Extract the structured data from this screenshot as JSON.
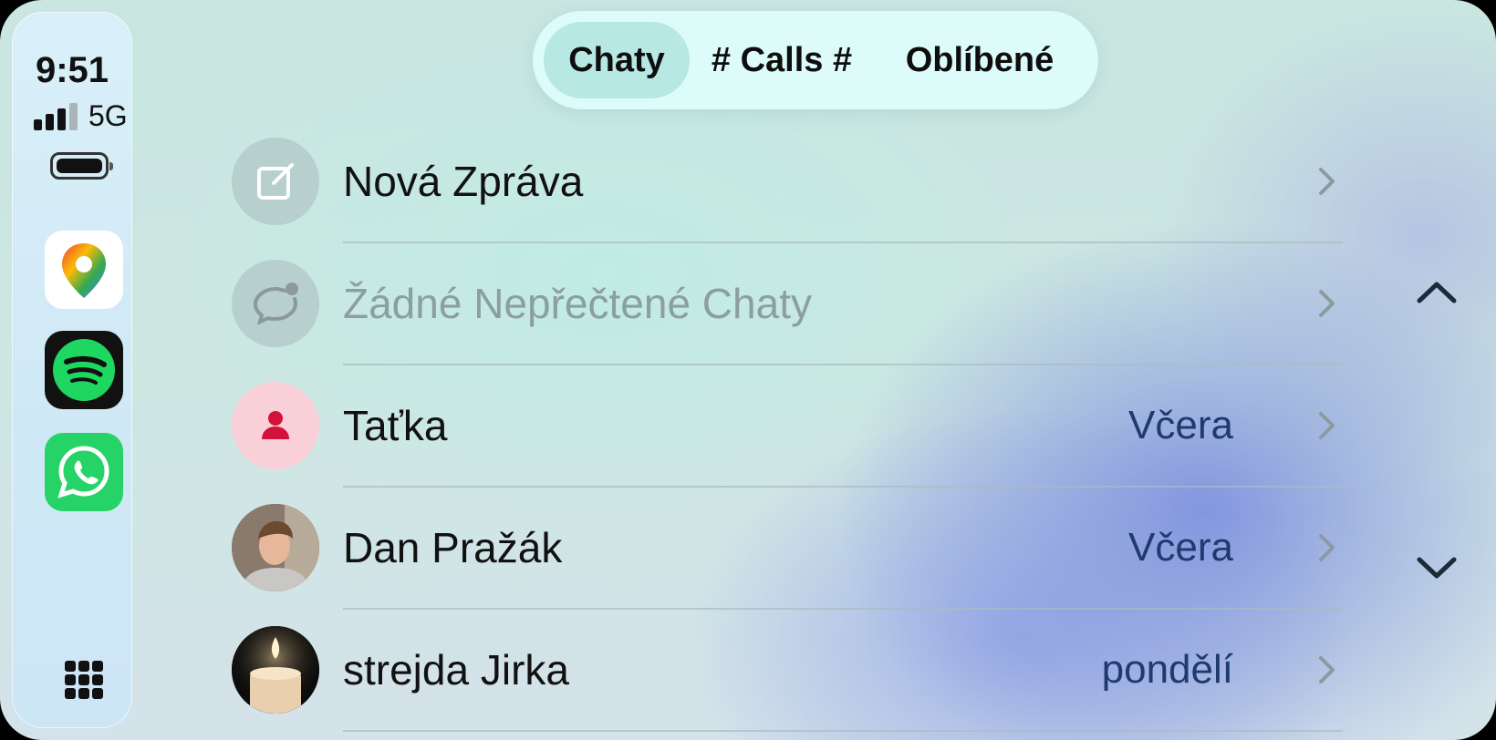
{
  "status_bar": {
    "time": "9:51",
    "network": "5G"
  },
  "dock": {
    "apps": [
      {
        "name": "Google Maps",
        "icon": "google-maps-icon"
      },
      {
        "name": "Spotify",
        "icon": "spotify-icon"
      },
      {
        "name": "WhatsApp",
        "icon": "whatsapp-icon"
      }
    ],
    "app_grid_icon": "app-grid-icon"
  },
  "tabs": [
    {
      "label": "Chaty",
      "active": true
    },
    {
      "label": "# Calls #",
      "active": false
    },
    {
      "label": "Oblíbené",
      "active": false
    }
  ],
  "list": [
    {
      "title": "Nová Zpráva",
      "date": "",
      "icon": "compose-icon"
    },
    {
      "title": "Žádné Nepřečtené Chaty",
      "date": "",
      "icon": "unread-chat-icon"
    },
    {
      "title": "Taťka",
      "date": "Včera",
      "icon": "person-icon"
    },
    {
      "title": "Dan Pražák",
      "date": "Včera",
      "icon": "avatar-photo"
    },
    {
      "title": "strejda Jirka",
      "date": "pondělí",
      "icon": "candle-photo"
    }
  ],
  "colors": {
    "accent_date": "#1f3a6e",
    "muted_text": "#8c9ea0",
    "spotify_green": "#1ed760",
    "whatsapp_green": "#25d366",
    "person_badge_bg": "#fad0d8",
    "person_badge_fg": "#d2123a"
  }
}
